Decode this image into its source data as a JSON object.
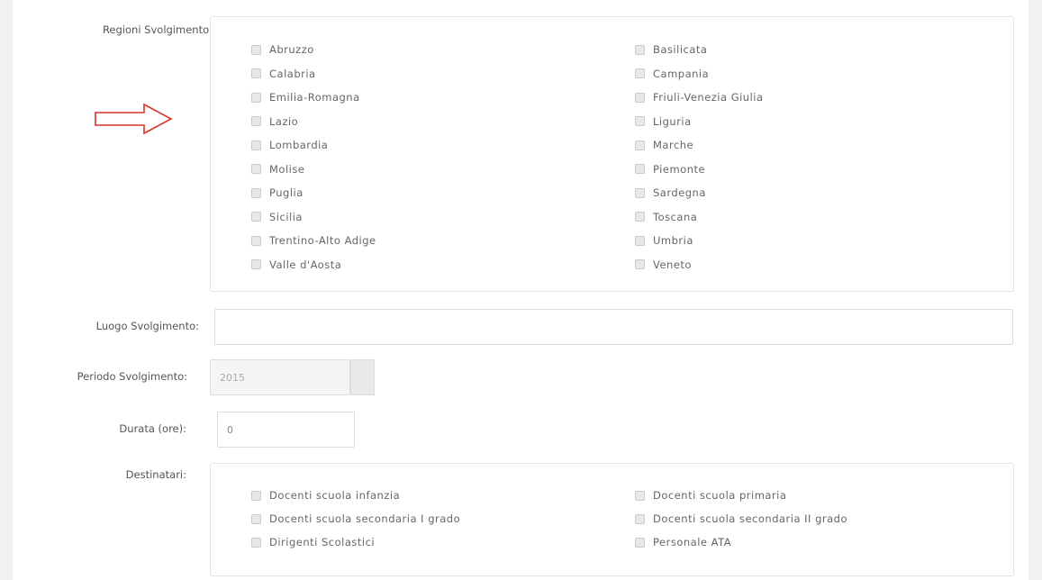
{
  "regioni": {
    "label": "Regioni Svolgimento:",
    "left": [
      "Abruzzo",
      "Calabria",
      "Emilia-Romagna",
      "Lazio",
      "Lombardia",
      "Molise",
      "Puglia",
      "Sicilia",
      "Trentino-Alto Adige",
      "Valle d'Aosta"
    ],
    "right": [
      "Basilicata",
      "Campania",
      "Friuli-Venezia Giulia",
      "Liguria",
      "Marche",
      "Piemonte",
      "Sardegna",
      "Toscana",
      "Umbria",
      "Veneto"
    ]
  },
  "luogo": {
    "label": "Luogo Svolgimento:",
    "value": ""
  },
  "periodo": {
    "label": "Periodo Svolgimento:",
    "value": "2015"
  },
  "durata": {
    "label": "Durata (ore):",
    "value": "0"
  },
  "destinatari": {
    "label": "Destinatari:",
    "left": [
      "Docenti scuola infanzia",
      "Docenti scuola secondaria I grado",
      "Dirigenti Scolastici"
    ],
    "right": [
      "Docenti scuola primaria",
      "Docenti scuola secondaria II grado",
      "Personale ATA"
    ]
  },
  "colors": {
    "arrow": "#d9342b",
    "border": "#e3e3e3"
  },
  "icons": {
    "annotation": "right-arrow-icon"
  }
}
